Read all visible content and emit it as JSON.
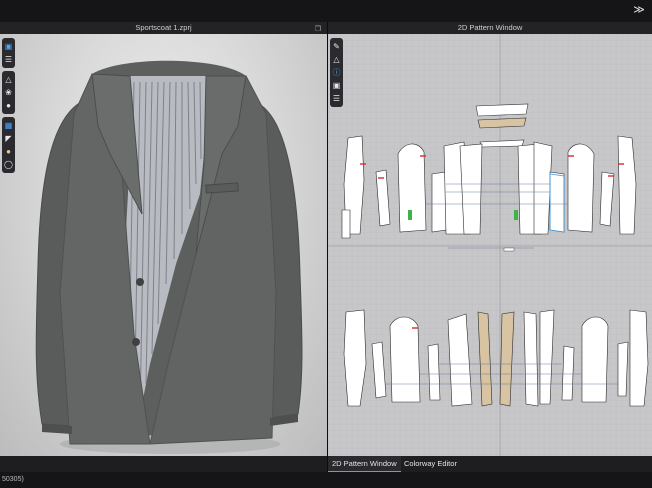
{
  "window": {
    "collapse_icon": "double-chevron-down-icon"
  },
  "left_pane": {
    "title": "Sportscoat 1.zprj",
    "tools": [
      [
        "cube-icon",
        "layers-icon"
      ],
      [
        "shirt-icon",
        "fabric-icon",
        "avatar-icon"
      ],
      [
        "file-icon",
        "texture-icon",
        "light-icon",
        "globe-icon"
      ]
    ]
  },
  "right_pane": {
    "title": "2D Pattern Window",
    "tools": [
      [
        "pen-icon",
        "shirt-icon",
        "info-icon",
        "fabric-icon",
        "layers-icon"
      ]
    ]
  },
  "tabs": [
    "2D Pattern Window",
    "Colorway Editor"
  ],
  "status": {
    "text": "50305)"
  },
  "colors": {
    "accent": "#4aa3ff",
    "garment": "#5b5d5c",
    "lining": "#b9bcc2",
    "pattern_piece": "#ffffff",
    "binding": "#d8c3a2"
  }
}
